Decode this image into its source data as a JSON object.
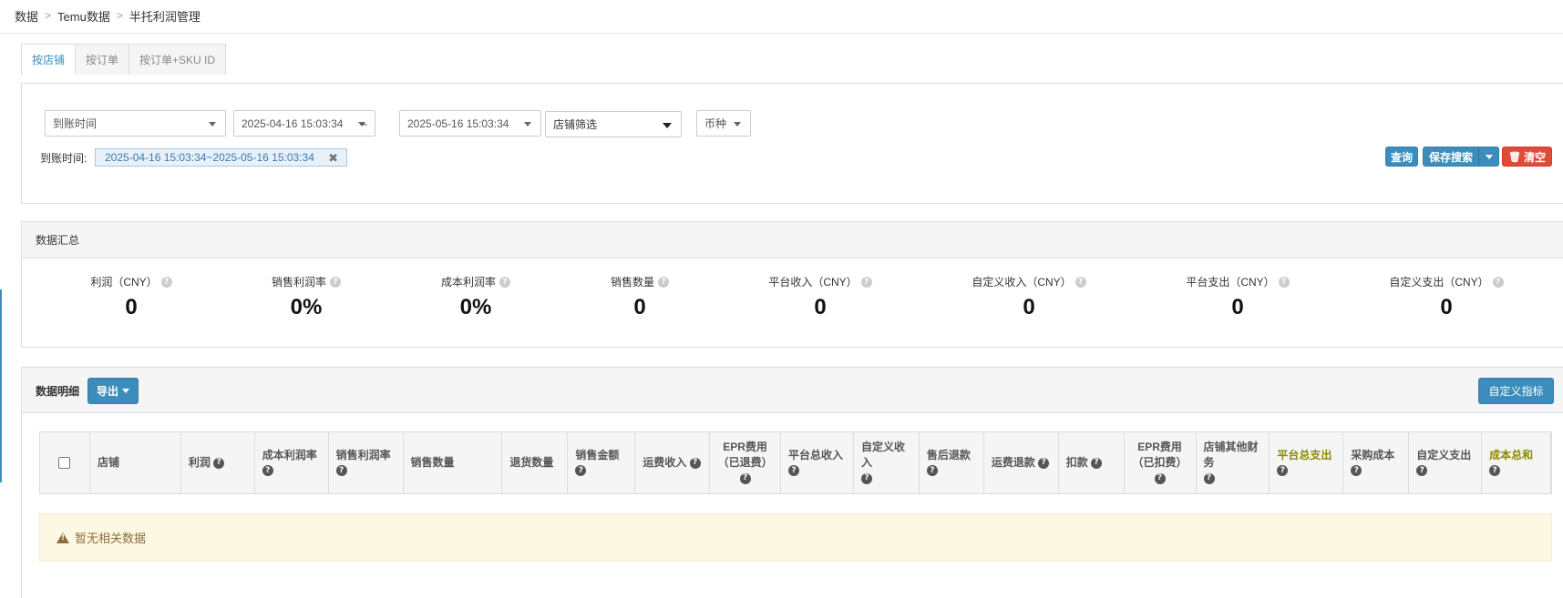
{
  "breadcrumb": [
    "数据",
    "Temu数据",
    "半托利润管理"
  ],
  "tabs": [
    {
      "label": "按店铺",
      "active": true
    },
    {
      "label": "按订单",
      "active": false
    },
    {
      "label": "按订单+SKU ID",
      "active": false
    }
  ],
  "filters": {
    "time_type": "到账时间",
    "start": "2025-04-16 15:03:34",
    "tilde": "~",
    "end": "2025-05-16 15:03:34",
    "store": "店铺筛选",
    "currency": "币种",
    "condition_label": "到账时间:",
    "condition_value": "2025-04-16 15:03:34~2025-05-16 15:03:34"
  },
  "buttons": {
    "query": "查询",
    "save_search": "保存搜索",
    "clear": "清空",
    "export": "导出",
    "custom_metrics": "自定义指标"
  },
  "summary": {
    "title": "数据汇总",
    "metrics": [
      {
        "label": "利润（CNY）",
        "value": "0"
      },
      {
        "label": "销售利润率",
        "value": "0%"
      },
      {
        "label": "成本利润率",
        "value": "0%"
      },
      {
        "label": "销售数量",
        "value": "0"
      },
      {
        "label": "平台收入（CNY）",
        "value": "0"
      },
      {
        "label": "自定义收入（CNY）",
        "value": "0"
      },
      {
        "label": "平台支出（CNY）",
        "value": "0"
      },
      {
        "label": "自定义支出（CNY）",
        "value": "0"
      }
    ]
  },
  "detail": {
    "title": "数据明细",
    "columns": [
      {
        "l1": "店铺",
        "l2": "",
        "help": false,
        "gold": false
      },
      {
        "l1": "利润",
        "l2": "",
        "help": true,
        "gold": false
      },
      {
        "l1": "成本利润率",
        "l2": "",
        "help": true,
        "gold": false
      },
      {
        "l1": "销售利润率",
        "l2": "",
        "help": true,
        "gold": false
      },
      {
        "l1": "销售数量",
        "l2": "",
        "help": false,
        "gold": false
      },
      {
        "l1": "退货数量",
        "l2": "",
        "help": false,
        "gold": false
      },
      {
        "l1": "销售金额",
        "l2": "",
        "help": true,
        "gold": false
      },
      {
        "l1": "运费收入",
        "l2": "",
        "help": true,
        "gold": false
      },
      {
        "l1": "EPR费用",
        "l2": "（已退费）",
        "help": true,
        "gold": false
      },
      {
        "l1": "平台总收入",
        "l2": "",
        "help": true,
        "gold": false
      },
      {
        "l1": "自定义收",
        "l2": "入",
        "help": true,
        "gold": false
      },
      {
        "l1": "售后退款",
        "l2": "",
        "help": true,
        "gold": false
      },
      {
        "l1": "运费退款",
        "l2": "",
        "help": true,
        "gold": false
      },
      {
        "l1": "扣款",
        "l2": "",
        "help": true,
        "gold": false
      },
      {
        "l1": "EPR费用",
        "l2": "（已扣费）",
        "help": true,
        "gold": false
      },
      {
        "l1": "店铺其他财",
        "l2": "务",
        "help": true,
        "gold": false
      },
      {
        "l1": "平台总支出",
        "l2": "",
        "help": true,
        "gold": true
      },
      {
        "l1": "采购成本",
        "l2": "",
        "help": true,
        "gold": false
      },
      {
        "l1": "自定义支出",
        "l2": "",
        "help": true,
        "gold": false
      },
      {
        "l1": "成本总和",
        "l2": "",
        "help": true,
        "gold": true
      }
    ],
    "empty_text": "暂无相关数据"
  },
  "colors": {
    "accent": "#3c8dbc",
    "danger": "#dd4b39",
    "gold": "#8b8b00",
    "alert_bg": "#fcf8e3"
  }
}
